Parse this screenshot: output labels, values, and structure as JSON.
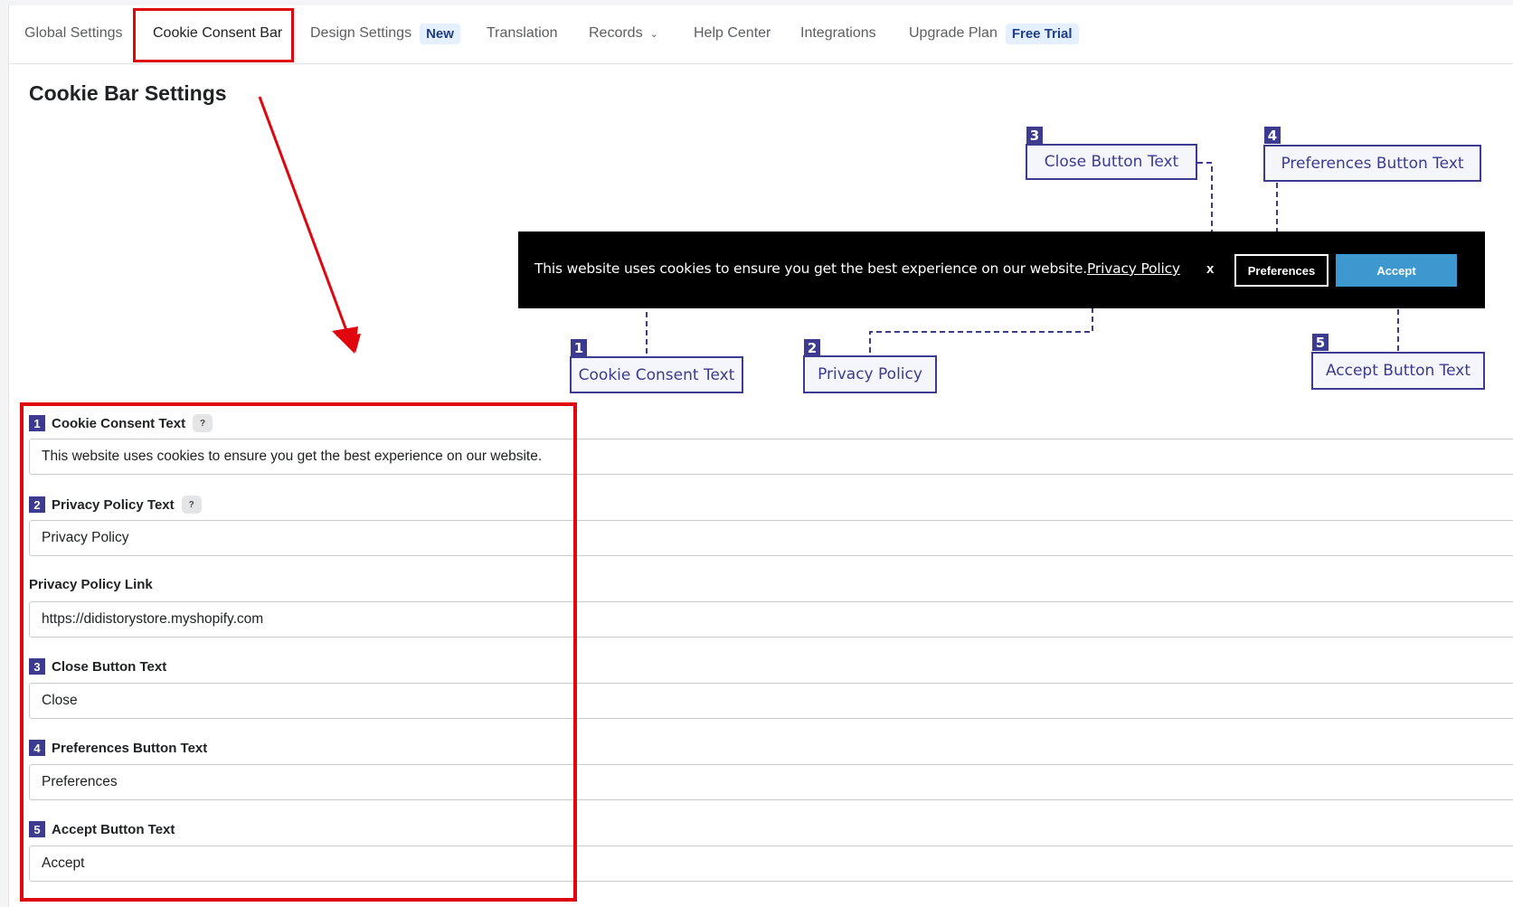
{
  "tabs": [
    {
      "label": "Global Settings"
    },
    {
      "label": "Cookie Consent Bar",
      "active": true
    },
    {
      "label": "Design Settings",
      "badge": "New"
    },
    {
      "label": "Translation"
    },
    {
      "label": "Records",
      "icon": "chevron-down-icon"
    },
    {
      "label": "Help Center"
    },
    {
      "label": "Integrations"
    },
    {
      "label": "Upgrade Plan",
      "badge": "Free Trial"
    }
  ],
  "page_title": "Cookie Bar Settings",
  "preview": {
    "text": "This website uses cookies to ensure you get the best experience on our website.",
    "privacy_link": "Privacy Policy",
    "close": "x",
    "preferences": "Preferences",
    "accept": "Accept",
    "bar_color": "#000000",
    "accept_color": "#3e98d0"
  },
  "callouts": [
    {
      "num": "1",
      "label": "Cookie Consent Text"
    },
    {
      "num": "2",
      "label": "Privacy Policy"
    },
    {
      "num": "3",
      "label": "Close Button Text"
    },
    {
      "num": "4",
      "label": "Preferences Button Text"
    },
    {
      "num": "5",
      "label": "Accept Button Text"
    }
  ],
  "form": {
    "fields": [
      {
        "num": "1",
        "label": "Cookie Consent Text",
        "help": "?",
        "value": "This website uses cookies to ensure you get the best experience on our website."
      },
      {
        "num": "2",
        "label": "Privacy Policy Text",
        "help": "?",
        "value": "Privacy Policy"
      },
      {
        "label": "Privacy Policy Link",
        "value": "https://didistorystore.myshopify.com"
      },
      {
        "num": "3",
        "label": "Close Button Text",
        "value": "Close"
      },
      {
        "num": "4",
        "label": "Preferences Button Text",
        "value": "Preferences"
      },
      {
        "num": "5",
        "label": "Accept Button Text",
        "value": "Accept"
      }
    ]
  },
  "colors": {
    "highlight": "#e0060e",
    "callout": "#3c3b8f",
    "badge_bg": "#e4efff"
  }
}
